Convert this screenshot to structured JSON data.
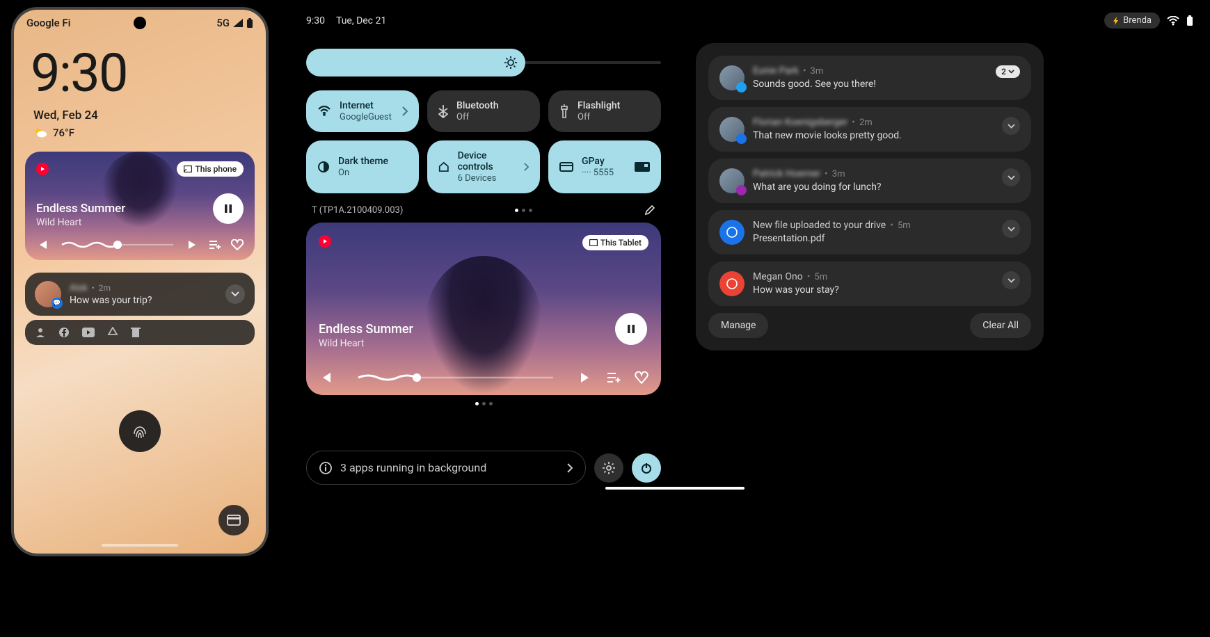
{
  "phone": {
    "carrier": "Google Fi",
    "net": "5G",
    "clock": "9:30",
    "date": "Wed, Feb 24",
    "temp": "76°F",
    "media": {
      "title": "Endless Summer",
      "artist": "Wild Heart",
      "cast": "This phone"
    },
    "notif1": {
      "sender": "Alok",
      "time": "2m",
      "text": "How was your trip?"
    }
  },
  "tablet": {
    "time": "9:30",
    "date": "Tue, Dec 21",
    "user": "Brenda",
    "build": "T (TP1A.2100409.003)",
    "apps_running": "3 apps running in background",
    "media": {
      "title": "Endless Summer",
      "artist": "Wild Heart",
      "cast": "This Tablet"
    },
    "tiles": {
      "internet": {
        "label": "Internet",
        "sub": "GoogleGuest"
      },
      "bluetooth": {
        "label": "Bluetooth",
        "sub": "Off"
      },
      "flashlight": {
        "label": "Flashlight",
        "sub": "Off"
      },
      "dark": {
        "label": "Dark theme",
        "sub": "On"
      },
      "device": {
        "label": "Device controls",
        "sub": "6 Devices"
      },
      "gpay": {
        "label": "GPay",
        "sub": "···· 5555"
      }
    }
  },
  "notifications": [
    {
      "sender": "Eunie Park",
      "time": "3m",
      "text": "Sounds good. See you there!",
      "count": "2",
      "badge_color": "#1da1f2",
      "blur": true
    },
    {
      "sender": "Florian Koenigsberger",
      "time": "2m",
      "text": "That new movie looks pretty good.",
      "badge_color": "#1a73e8",
      "blur": true
    },
    {
      "sender": "Patrick Hoerner",
      "time": "3m",
      "text": "What are you doing for lunch?",
      "badge_color": "#9c27b0",
      "blur": true
    },
    {
      "sender": "New file uploaded to your drive",
      "time": "5m",
      "text": "Presentation.pdf",
      "badge_color": "#1a73e8",
      "blur": false,
      "icon": true
    },
    {
      "sender": "Megan Ono",
      "time": "5m",
      "text": "How was your stay?",
      "badge_color": "#ea4335",
      "blur": false,
      "icon": true
    }
  ],
  "actions": {
    "manage": "Manage",
    "clear": "Clear All"
  },
  "colors": {
    "accent": "#a6dde8"
  }
}
